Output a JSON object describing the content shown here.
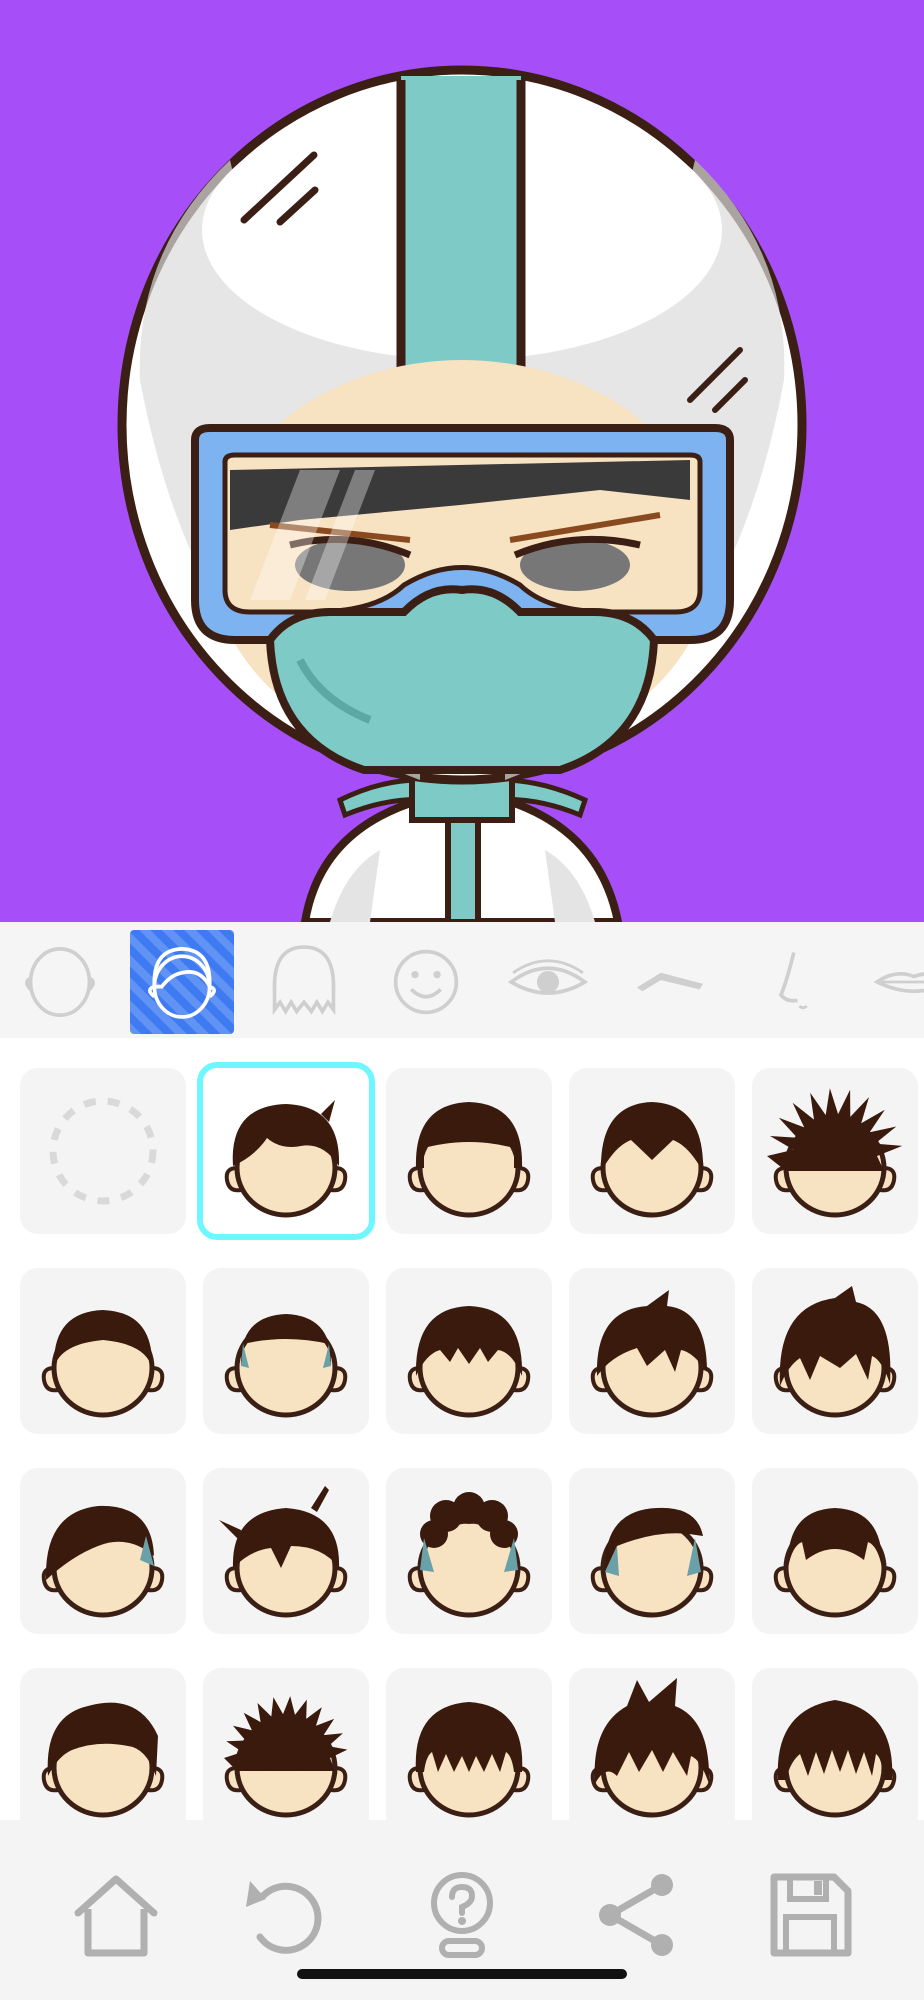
{
  "app": {
    "canvas_background": "#a64ff9",
    "accent": "#3e7bf2",
    "selection_color": "#6ff7ff",
    "hair_color": "#3a1a0c",
    "skin_color": "#f7e2c2"
  },
  "avatar": {
    "icons": [
      "helmet-icon",
      "goggles-icon",
      "face-mask-icon",
      "suit-icon"
    ]
  },
  "category_tabs": [
    {
      "name": "face-shape",
      "icon": "face-outline-icon",
      "active": false
    },
    {
      "name": "hair",
      "icon": "hair-outline-icon",
      "active": true
    },
    {
      "name": "back-hair",
      "icon": "back-hair-icon",
      "active": false
    },
    {
      "name": "expression",
      "icon": "smiley-icon",
      "active": false
    },
    {
      "name": "eyes",
      "icon": "eye-icon",
      "active": false
    },
    {
      "name": "eyebrows",
      "icon": "eyebrow-icon",
      "active": false
    },
    {
      "name": "nose",
      "icon": "nose-icon",
      "active": false
    },
    {
      "name": "mouth",
      "icon": "lips-icon",
      "active": false
    }
  ],
  "hair_options": [
    {
      "name": "none",
      "style": "none",
      "selected": false
    },
    {
      "name": "swoop",
      "style": "swoop",
      "selected": true
    },
    {
      "name": "bowl",
      "style": "bowl",
      "selected": false
    },
    {
      "name": "center-part",
      "style": "centerpart",
      "selected": false
    },
    {
      "name": "spiky-wild",
      "style": "spiky",
      "selected": false
    },
    {
      "name": "buzz",
      "style": "buzz",
      "selected": false
    },
    {
      "name": "short-crop",
      "style": "crop",
      "selected": false
    },
    {
      "name": "fringe",
      "style": "fringe",
      "selected": false
    },
    {
      "name": "tousled",
      "style": "tousled",
      "selected": false
    },
    {
      "name": "shag",
      "style": "shag",
      "selected": false
    },
    {
      "name": "side-sweep",
      "style": "sidesweep",
      "selected": false
    },
    {
      "name": "topknot",
      "style": "topknot",
      "selected": false
    },
    {
      "name": "curly-top",
      "style": "curly",
      "selected": false
    },
    {
      "name": "undercut",
      "style": "undercut",
      "selected": false
    },
    {
      "name": "crew",
      "style": "crew",
      "selected": false
    },
    {
      "name": "quiff",
      "style": "quiff",
      "selected": false
    },
    {
      "name": "messy-spikes",
      "style": "messy",
      "selected": false
    },
    {
      "name": "straight-bangs",
      "style": "bangs",
      "selected": false
    },
    {
      "name": "tall-spikes",
      "style": "tallspikes",
      "selected": false
    },
    {
      "name": "long-textured",
      "style": "textured",
      "selected": false
    }
  ],
  "toolbar": [
    {
      "name": "home-button",
      "icon": "home-icon"
    },
    {
      "name": "undo-button",
      "icon": "undo-icon"
    },
    {
      "name": "hint-button",
      "icon": "hint-icon"
    },
    {
      "name": "share-button",
      "icon": "share-icon"
    },
    {
      "name": "save-button",
      "icon": "save-icon"
    }
  ]
}
